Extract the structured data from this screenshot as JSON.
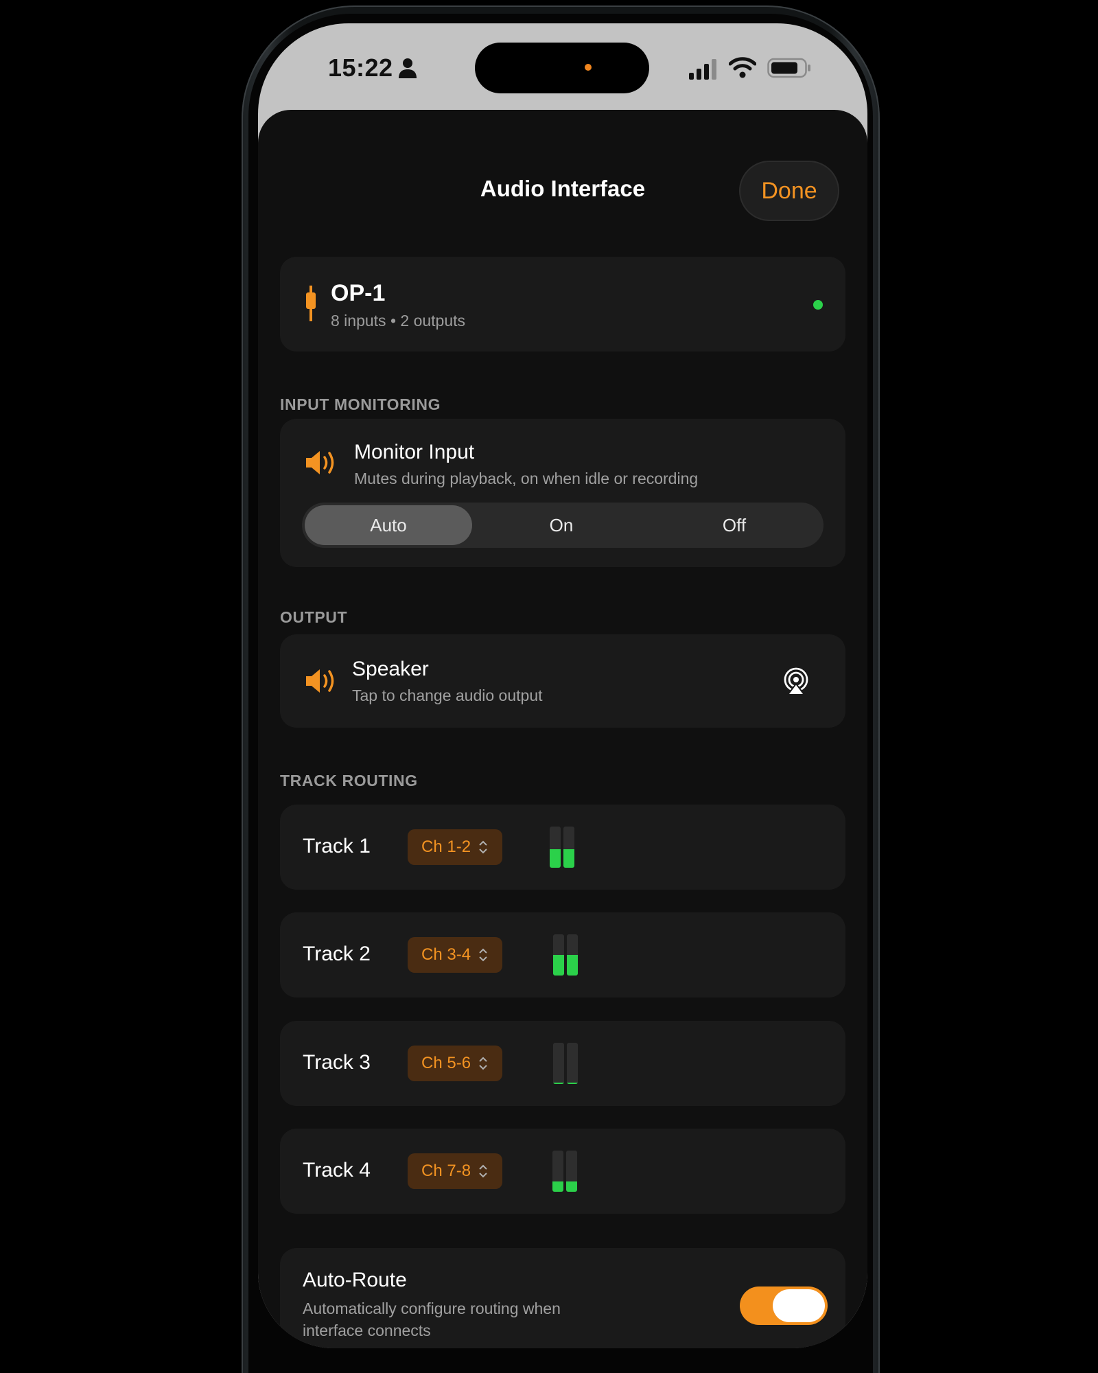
{
  "status_bar": {
    "time": "15:22"
  },
  "sheet": {
    "title": "Audio Interface",
    "done_label": "Done"
  },
  "device": {
    "name": "OP-1",
    "specs": "8 inputs • 2 outputs",
    "status_color": "#2bd14a"
  },
  "sections": {
    "input_monitoring": "INPUT MONITORING",
    "output": "OUTPUT",
    "track_routing": "TRACK ROUTING"
  },
  "monitor": {
    "title": "Monitor Input",
    "subtitle": "Mutes during playback, on when idle or recording",
    "options": [
      "Auto",
      "On",
      "Off"
    ],
    "selected": "Auto"
  },
  "output": {
    "title": "Speaker",
    "subtitle": "Tap to change audio output"
  },
  "tracks": [
    {
      "name": "Track 1",
      "channel": "Ch 1-2",
      "levels": [
        0.45,
        0.45
      ]
    },
    {
      "name": "Track 2",
      "channel": "Ch 3-4",
      "levels": [
        0.5,
        0.5
      ]
    },
    {
      "name": "Track 3",
      "channel": "Ch 5-6",
      "levels": [
        0.03,
        0.03
      ]
    },
    {
      "name": "Track 4",
      "channel": "Ch 7-8",
      "levels": [
        0.25,
        0.25
      ]
    }
  ],
  "auto_route": {
    "title": "Auto-Route",
    "subtitle": "Automatically configure routing when interface connects",
    "enabled": true
  },
  "colors": {
    "accent": "#f39322",
    "meter": "#2bd14a",
    "toggle_on": "#f3901d"
  }
}
